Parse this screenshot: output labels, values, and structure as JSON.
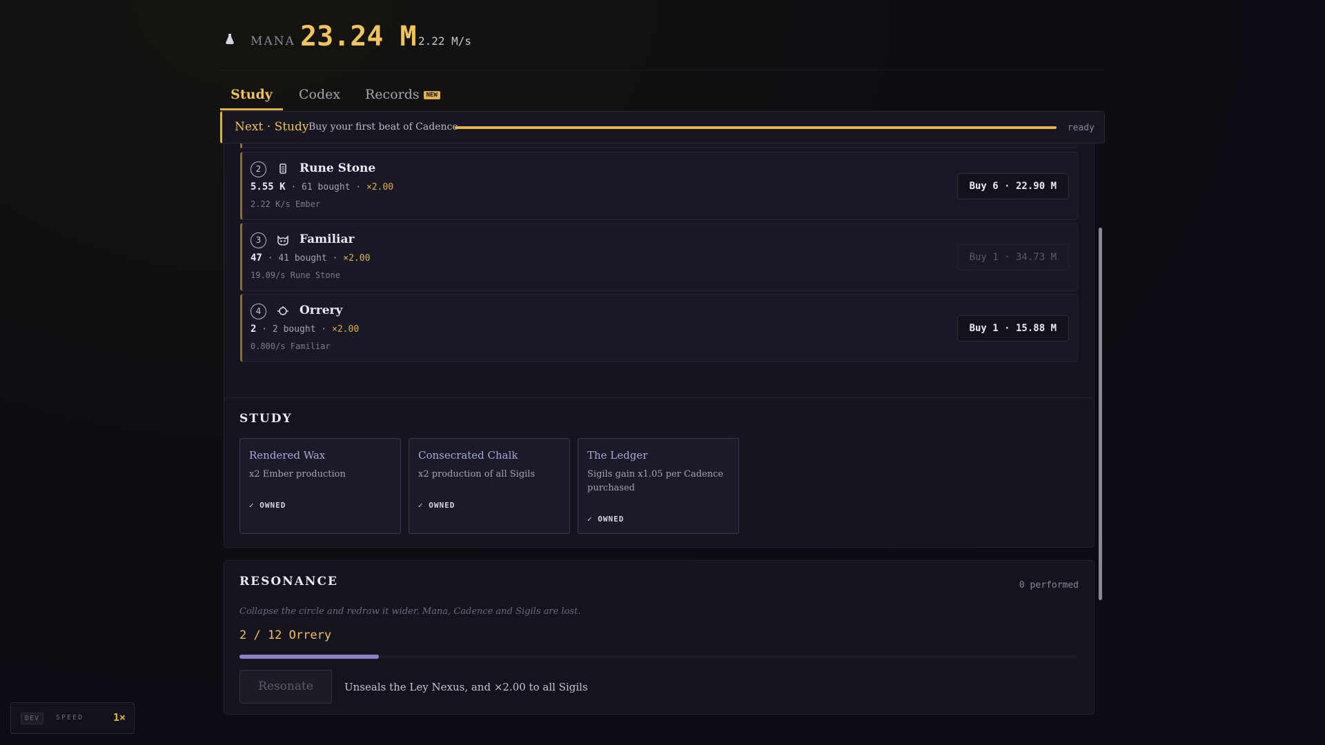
{
  "header": {
    "mana_label": "MANA",
    "mana_value": "23.24 M",
    "mana_rate": "2.22 M/s",
    "mana_icon": "flask-icon"
  },
  "tabs": [
    {
      "label": "Study",
      "active": true
    },
    {
      "label": "Codex",
      "active": false
    },
    {
      "label": "Records",
      "active": false,
      "badge": "NEW"
    }
  ],
  "next": {
    "title": "Next · Study",
    "description": "Buy your first beat of Cadence",
    "status": "ready",
    "progress": 1.0
  },
  "generators": [
    {
      "num": "2",
      "icon": "rune-stone-icon",
      "name": "Rune Stone",
      "amount": "5.55 K",
      "bought": "· 61 bought ·",
      "mult": "×2.00",
      "rate": "2.22 K/s Ember",
      "buy": "Buy 6 · 22.90 M",
      "affordable": true
    },
    {
      "num": "3",
      "icon": "cat-icon",
      "name": "Familiar",
      "amount": "47",
      "bought": "· 41 bought ·",
      "mult": "×2.00",
      "rate": "19.09/s Rune Stone",
      "buy": "Buy 1 · 34.73 M",
      "affordable": false
    },
    {
      "num": "4",
      "icon": "orbit-icon",
      "name": "Orrery",
      "amount": "2",
      "bought": "· 2 bought ·",
      "mult": "×2.00",
      "rate": "0.800/s Familiar",
      "buy": "Buy 1 · 15.88 M",
      "affordable": true
    }
  ],
  "study": {
    "title": "STUDY",
    "upgrades": [
      {
        "name": "Rendered Wax",
        "desc": "x2 Ember production",
        "status": "✓ OWNED"
      },
      {
        "name": "Consecrated Chalk",
        "desc": "x2 production of all Sigils",
        "status": "✓ OWNED"
      },
      {
        "name": "The Ledger",
        "desc": "Sigils gain x1.05 per Cadence purchased",
        "status": "✓ OWNED"
      }
    ]
  },
  "resonance": {
    "title": "RESONANCE",
    "count": "0 performed",
    "description": "Collapse the circle and redraw it wider. Mana, Cadence and Sigils are lost.",
    "progress_text": "2 / 12 Orrery",
    "progress": 0.1667,
    "button": "Resonate",
    "effect": "Unseals the Ley Nexus, and ×2.00 to all Sigils"
  },
  "dev": {
    "tag": "DEV",
    "label": "SPEED",
    "value": "1×"
  },
  "colors": {
    "accent": "#e0b04c",
    "mana": "#f0c35c",
    "upgrade_name": "#a9a6d6",
    "resonance_bar": "#8a84c6"
  }
}
